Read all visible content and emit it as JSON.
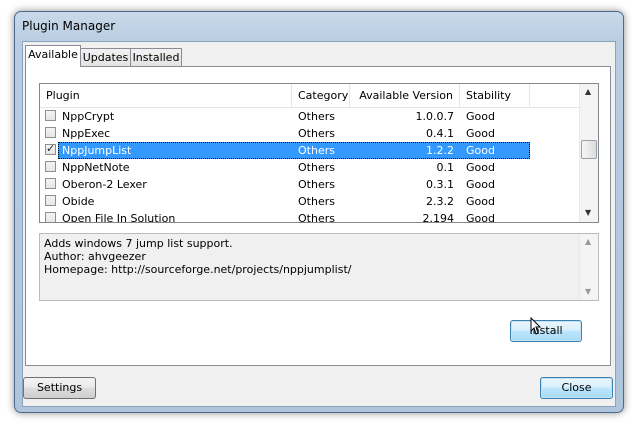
{
  "window": {
    "title": "Plugin Manager"
  },
  "tabs": [
    {
      "label": "Available"
    },
    {
      "label": "Updates"
    },
    {
      "label": "Installed"
    }
  ],
  "plugin_list": {
    "columns": [
      "Plugin",
      "Category",
      "Available Version",
      "Stability"
    ],
    "rows": [
      {
        "name": "NppCrypt",
        "category": "Others",
        "version": "1.0.0.7",
        "stability": "Good",
        "checked": false,
        "check": ""
      },
      {
        "name": "NppExec",
        "category": "Others",
        "version": "0.4.1",
        "stability": "Good",
        "checked": false,
        "check": ""
      },
      {
        "name": "NppJumpList",
        "category": "Others",
        "version": "1.2.2",
        "stability": "Good",
        "checked": true,
        "check": "✓",
        "selected": true
      },
      {
        "name": "NppNetNote",
        "category": "Others",
        "version": "0.1",
        "stability": "Good",
        "checked": false,
        "check": ""
      },
      {
        "name": "Oberon-2 Lexer",
        "category": "Others",
        "version": "0.3.1",
        "stability": "Good",
        "checked": false,
        "check": ""
      },
      {
        "name": "Obide",
        "category": "Others",
        "version": "2.3.2",
        "stability": "Good",
        "checked": false,
        "check": ""
      },
      {
        "name": "Open File In Solution",
        "category": "Others",
        "version": "2.194",
        "stability": "Good",
        "checked": false,
        "check": ""
      }
    ]
  },
  "description": {
    "lines": [
      "Adds windows 7 jump list support.",
      "Author: ahvgeezer",
      "Homepage: http://sourceforge.net/projects/nppjumplist/"
    ]
  },
  "buttons": {
    "install": "Install",
    "settings": "Settings",
    "close": "Close"
  },
  "icons": {
    "scroll_up": "▲",
    "scroll_down": "▼",
    "cursor": "arrow-cursor-icon"
  }
}
